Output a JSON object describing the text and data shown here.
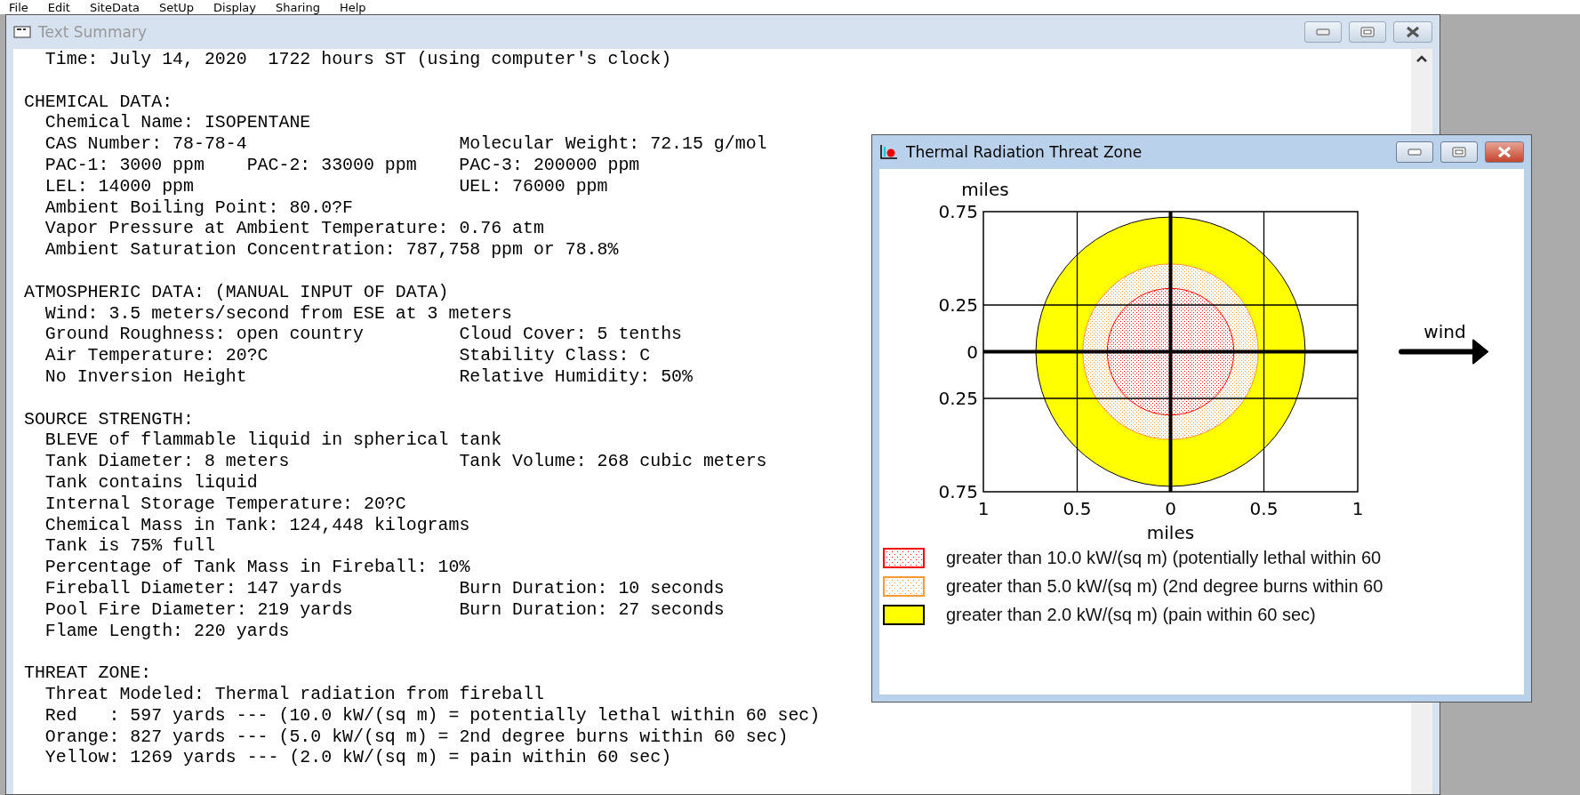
{
  "menu_bar": [
    "File",
    "Edit",
    "SiteData",
    "SetUp",
    "Display",
    "Sharing",
    "Help"
  ],
  "text_summary_window": {
    "title": "Text Summary",
    "active": false,
    "lines": [
      {
        "kind": "item",
        "cells": [
          "Time: July 14, 2020  1722 hours ST (using computer's clock)"
        ]
      },
      {
        "kind": "blank"
      },
      {
        "kind": "heading",
        "cells": [
          "CHEMICAL DATA:"
        ]
      },
      {
        "kind": "item",
        "cells": [
          "Chemical Name: ISOPENTANE"
        ]
      },
      {
        "kind": "item",
        "cells": [
          "CAS Number: 78-78-4",
          "Molecular Weight: 72.15 g/mol"
        ]
      },
      {
        "kind": "item",
        "cells": [
          "PAC-1: 3000 ppm",
          "PAC-2: 33000 ppm",
          "PAC-3: 200000 ppm"
        ]
      },
      {
        "kind": "item",
        "cells": [
          "LEL: 14000 ppm",
          "UEL: 76000 ppm"
        ]
      },
      {
        "kind": "item",
        "cells": [
          "Ambient Boiling Point: 80.0?F"
        ]
      },
      {
        "kind": "item",
        "cells": [
          "Vapor Pressure at Ambient Temperature: 0.76 atm"
        ]
      },
      {
        "kind": "item",
        "cells": [
          "Ambient Saturation Concentration: 787,758 ppm or 78.8%"
        ]
      },
      {
        "kind": "blank"
      },
      {
        "kind": "heading",
        "cells": [
          "ATMOSPHERIC DATA: (MANUAL INPUT OF DATA)"
        ]
      },
      {
        "kind": "item",
        "cells": [
          "Wind: 3.5 meters/second from ESE at 3 meters"
        ]
      },
      {
        "kind": "item",
        "cells": [
          "Ground Roughness: open country",
          "Cloud Cover: 5 tenths"
        ]
      },
      {
        "kind": "item",
        "cells": [
          "Air Temperature: 20?C",
          "Stability Class: C"
        ]
      },
      {
        "kind": "item",
        "cells": [
          "No Inversion Height",
          "Relative Humidity: 50%"
        ]
      },
      {
        "kind": "blank"
      },
      {
        "kind": "heading",
        "cells": [
          "SOURCE STRENGTH:"
        ]
      },
      {
        "kind": "item",
        "cells": [
          "BLEVE of flammable liquid in spherical tank"
        ]
      },
      {
        "kind": "item",
        "cells": [
          "Tank Diameter: 8 meters",
          "Tank Volume: 268 cubic meters"
        ]
      },
      {
        "kind": "item",
        "cells": [
          "Tank contains liquid"
        ]
      },
      {
        "kind": "item",
        "cells": [
          "Internal Storage Temperature: 20?C"
        ]
      },
      {
        "kind": "item",
        "cells": [
          "Chemical Mass in Tank: 124,448 kilograms"
        ]
      },
      {
        "kind": "item",
        "cells": [
          "Tank is 75% full"
        ]
      },
      {
        "kind": "item",
        "cells": [
          "Percentage of Tank Mass in Fireball: 10%"
        ]
      },
      {
        "kind": "item",
        "cells": [
          "Fireball Diameter: 147 yards",
          "Burn Duration: 10 seconds"
        ]
      },
      {
        "kind": "item",
        "cells": [
          "Pool Fire Diameter: 219 yards",
          "Burn Duration: 27 seconds"
        ]
      },
      {
        "kind": "item",
        "cells": [
          "Flame Length: 220 yards"
        ]
      },
      {
        "kind": "blank"
      },
      {
        "kind": "heading",
        "cells": [
          "THREAT ZONE:"
        ]
      },
      {
        "kind": "item",
        "cells": [
          "Threat Modeled: Thermal radiation from fireball"
        ]
      },
      {
        "kind": "item",
        "cells": [
          "Red   : 597 yards --- (10.0 kW/(sq m) = potentially lethal within 60 sec)"
        ]
      },
      {
        "kind": "item",
        "cells": [
          "Orange: 827 yards --- (5.0 kW/(sq m) = 2nd degree burns within 60 sec)"
        ]
      },
      {
        "kind": "item",
        "cells": [
          "Yellow: 1269 yards --- (2.0 kW/(sq m) = pain within 60 sec)"
        ]
      }
    ]
  },
  "threat_zone_window": {
    "title": "Thermal Radiation Threat Zone",
    "active": true,
    "y_axis_label": "miles",
    "x_axis_label": "miles",
    "y_ticks": [
      "0.75",
      "0.25",
      "0",
      "0.25",
      "0.75"
    ],
    "x_ticks": [
      "1",
      "0.5",
      "0",
      "0.5",
      "1"
    ],
    "wind_label": "wind",
    "legend": [
      {
        "kind": "dotted",
        "color": "#ff0000",
        "label": "greater than 10.0 kW/(sq m) (potentially lethal within 60"
      },
      {
        "kind": "dotted",
        "color": "#ff9933",
        "label": "greater than 5.0 kW/(sq m) (2nd degree burns within 60"
      },
      {
        "kind": "solid",
        "color": "#ffff00",
        "label": "greater than 2.0 kW/(sq m) (pain within 60 sec)"
      }
    ]
  }
}
